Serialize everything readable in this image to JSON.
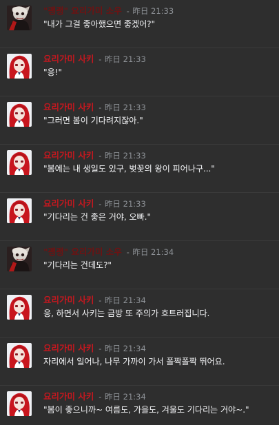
{
  "authors": {
    "master": {
      "name": "\"괭괭\" 요리가미 소우",
      "color": "#6f1212",
      "avatar": "skull-mask-avatar"
    },
    "saki": {
      "name": "요리가미 사키",
      "color": "#c4181f",
      "avatar": "red-hair-girl-avatar"
    }
  },
  "separator": "-",
  "messages": [
    {
      "author": "\"괭괭\" 요리가미 소우",
      "ts": "昨日 21:33",
      "text": "\"내가 그걸 좋아했으면 좋겠어?\""
    },
    {
      "author": "요리가미 사키",
      "ts": "昨日 21:33",
      "text": "\"응!\""
    },
    {
      "author": "요리가미 사키",
      "ts": "昨日 21:33",
      "text": "\"그러면 봄이 기다려지잖아.\""
    },
    {
      "author": "요리가미 사키",
      "ts": "昨日 21:33",
      "text": "\"봄에는 내 생일도 있구, 벚꽃의 왕이 피어나구...\""
    },
    {
      "author": "요리가미 사키",
      "ts": "昨日 21:33",
      "text": "\"기다리는 건 좋은 거야, 오빠.\""
    },
    {
      "author": "\"괭괭\" 요리가미 소우",
      "ts": "昨日 21:34",
      "text": "\"기다리는 건데도?\""
    },
    {
      "author": "요리가미 사키",
      "ts": "昨日 21:34",
      "text": "응, 하면서 사키는 금방 또 주의가 흐트러집니다."
    },
    {
      "author": "요리가미 사키",
      "ts": "昨日 21:34",
      "text": "자리에서 일어나, 나무 가까이 가서 폴짝폴짝 뛰어요."
    },
    {
      "author": "요리가미 사키",
      "ts": "昨日 21:34",
      "text": "\"봄이 좋으니까~ 여름도, 가을도, 겨울도 기다리는 거야~.\""
    }
  ]
}
